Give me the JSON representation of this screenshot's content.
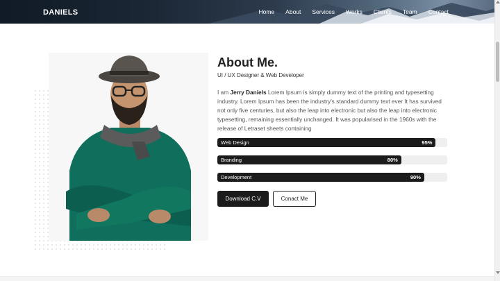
{
  "header": {
    "brand": "DANIELS",
    "nav": [
      "Home",
      "About",
      "Services",
      "Works",
      "Clients",
      "Team",
      "Contact"
    ]
  },
  "about": {
    "title": "About Me.",
    "subtitle": "UI / UX Designer & Web Developer",
    "bio_prefix": "I am ",
    "bio_name": "Jerry Daniels",
    "bio_rest": " Lorem Ipsum is simply dummy text of the printing and typesetting industry. Lorem Ipsum has been the industry's standard dummy text ever It has survived not only five centuries, but also the leap into electronic but also the leap into electronic typesetting, remaining essentially unchanged. It was popularised in the 1960s with the release of Letraset sheets containing"
  },
  "skills": [
    {
      "label": "Web Design",
      "percent_text": "95%",
      "value": 0.95
    },
    {
      "label": "Branding",
      "percent_text": "80%",
      "value": 0.8
    },
    {
      "label": "Development",
      "percent_text": "90%",
      "value": 0.9
    }
  ],
  "buttons": {
    "download": "Download C.V",
    "contact": "Conact Me"
  },
  "colors": {
    "accent": "#1b1b1b",
    "track": "#efefef",
    "sweater": "#0f6e5c"
  }
}
